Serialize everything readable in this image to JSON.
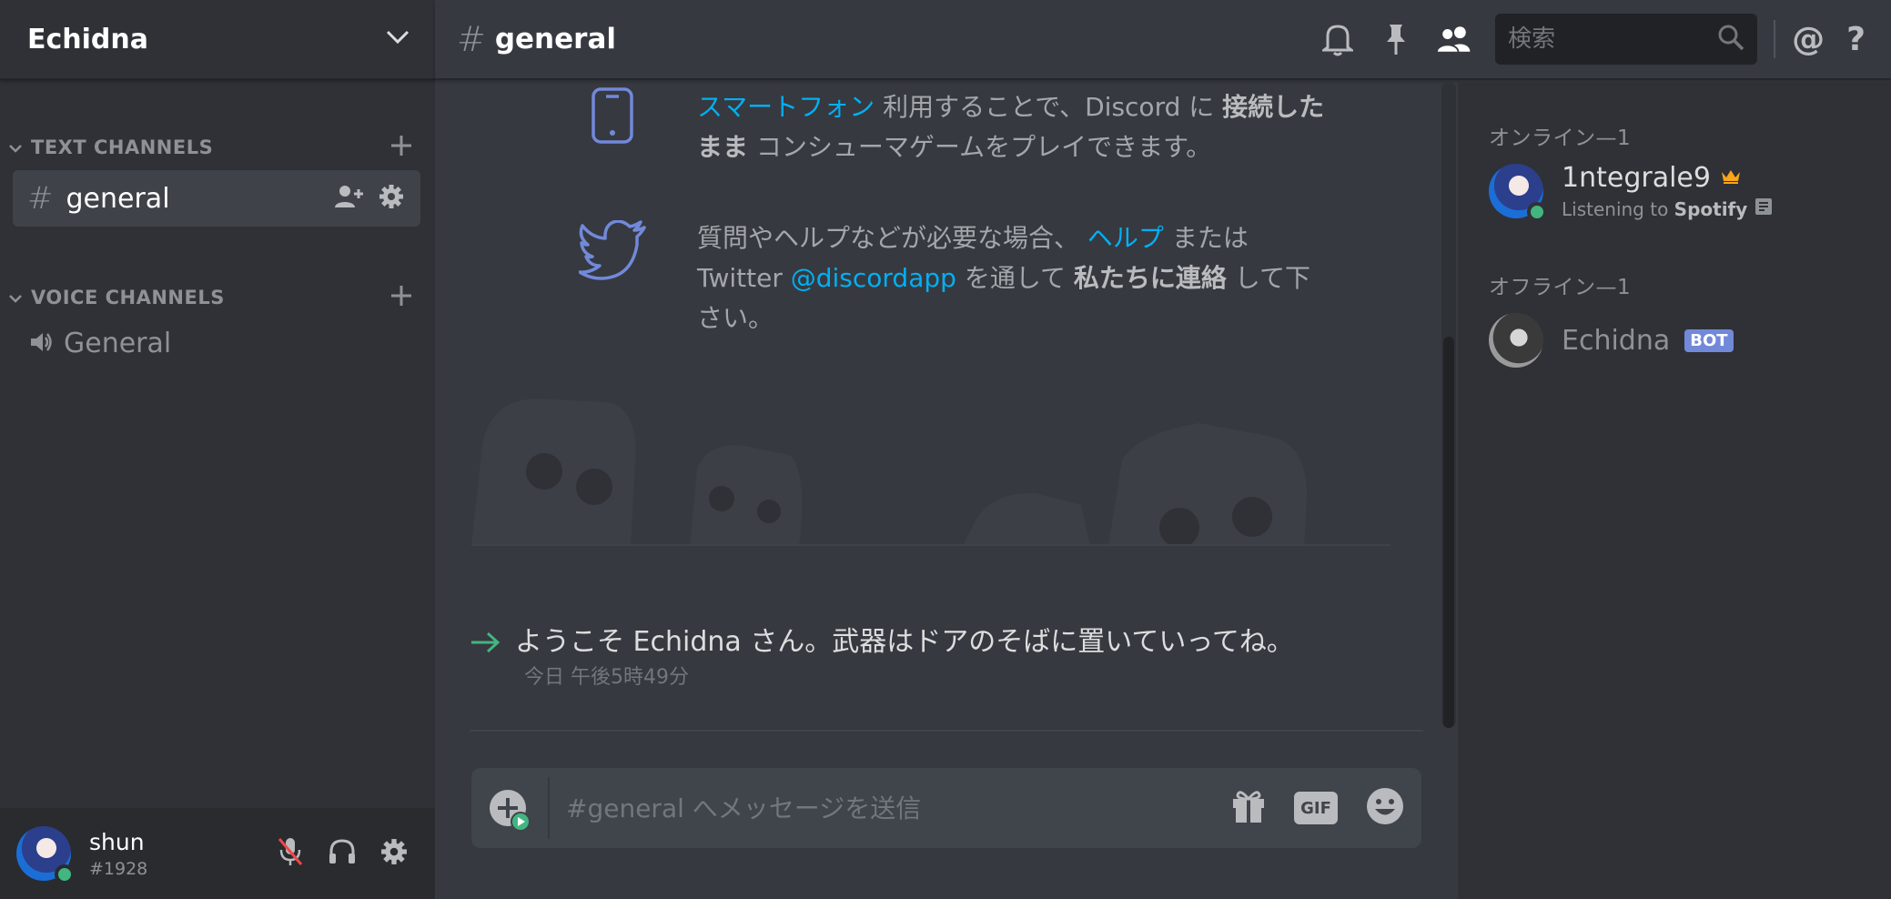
{
  "server": {
    "name": "Echidna"
  },
  "sidebar": {
    "text_category": "TEXT CHANNELS",
    "voice_category": "VOICE CHANNELS",
    "text_channels": [
      {
        "label": "general",
        "selected": true
      }
    ],
    "voice_channels": [
      {
        "label": "General"
      }
    ]
  },
  "user": {
    "name": "shun",
    "tag": "#1928",
    "status": "online"
  },
  "topbar": {
    "channel_name": "general",
    "search_placeholder": "検索",
    "mention_label": "@",
    "help_label": "?"
  },
  "chat": {
    "tip_mobile": {
      "link": "スマートフォン",
      "part1": " 利用することで、Discord に ",
      "bold": "接続したまま",
      "part2": " コンシューマゲームをプレイできます。"
    },
    "tip_help": {
      "part1": "質問やヘルプなどが必要な場合、 ",
      "link1": "ヘルプ",
      "part2": " または Twitter ",
      "link2": "@discordapp",
      "part3": " を通して ",
      "bold": "私たちに連絡",
      "part4": " して下さい。"
    },
    "welcome": {
      "text": "ようこそ Echidna さん。武器はドアのそばに置いていってね。",
      "timestamp": "今日 午後5時49分"
    },
    "composer_placeholder": "#general へメッセージを送信",
    "gif_label": "GIF"
  },
  "members": {
    "online_heading": "オンライン—1",
    "offline_heading": "オフライン—1",
    "online": [
      {
        "name": "1ntegrale9",
        "activity_prefix": "Listening to ",
        "activity_name": "Spotify",
        "owner": true
      }
    ],
    "offline": [
      {
        "name": "Echidna",
        "badge": "BOT"
      }
    ]
  },
  "colors": {
    "accent_link": "#00b0f4",
    "online_green": "#43b581",
    "bot_badge": "#7289da",
    "crown": "#faa61a",
    "tip_icon": "#7289da"
  }
}
